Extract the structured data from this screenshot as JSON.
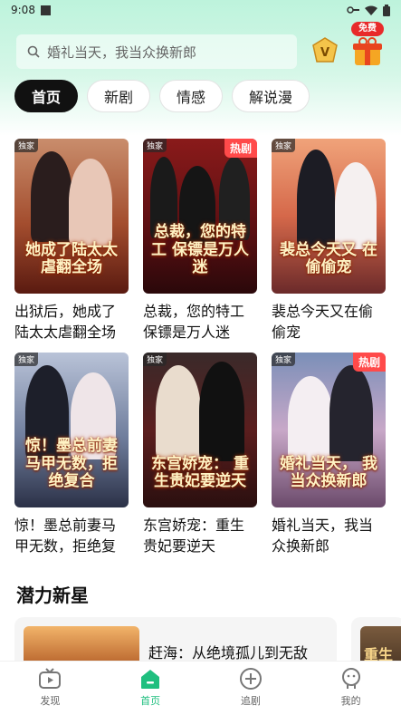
{
  "status": {
    "time": "9:08"
  },
  "search": {
    "placeholder": "婚礼当天，我当众换新郎"
  },
  "header": {
    "free_label": "免费"
  },
  "tabs": [
    {
      "label": "首页",
      "active": true
    },
    {
      "label": "新剧",
      "active": false
    },
    {
      "label": "情感",
      "active": false
    },
    {
      "label": "解说漫",
      "active": false
    }
  ],
  "cards": [
    {
      "title": "出狱后，她成了陆太太虐翻全场",
      "poster_text": "她成了陆太太 虐翻全场",
      "badge": "独家",
      "hot": ""
    },
    {
      "title": "总裁，您的特工保镖是万人迷",
      "poster_text": "总裁，您的特工 保镖是万人迷",
      "badge": "独家",
      "hot": "热剧"
    },
    {
      "title": "裴总今天又在偷偷宠",
      "poster_text": "裴总今天又 在偷偷宠",
      "badge": "独家",
      "hot": ""
    },
    {
      "title": "惊！墨总前妻马甲无数，拒绝复合",
      "poster_text": "惊！墨总前妻 马甲无数，拒绝复合",
      "badge": "独家",
      "hot": ""
    },
    {
      "title": "东宫娇宠：重生贵妃要逆天",
      "poster_text": "东宫娇宠： 重生贵妃要逆天",
      "badge": "独家",
      "hot": ""
    },
    {
      "title": "婚礼当天，我当众换新郎",
      "poster_text": "婚礼当天， 我当众换新郎",
      "badge": "独家",
      "hot": "热剧"
    }
  ],
  "section": {
    "title": "潜力新星"
  },
  "recommend": [
    {
      "title": "赶海：从绝境孤儿到无敌"
    },
    {
      "poster_text": "重生"
    }
  ],
  "nav": [
    {
      "label": "发现",
      "active": false
    },
    {
      "label": "首页",
      "active": true
    },
    {
      "label": "追剧",
      "active": false
    },
    {
      "label": "我的",
      "active": false
    }
  ],
  "colors": {
    "accent": "#1fbf7f",
    "hot_badge": "#ff4a4a",
    "free_badge": "#e82a2a"
  }
}
